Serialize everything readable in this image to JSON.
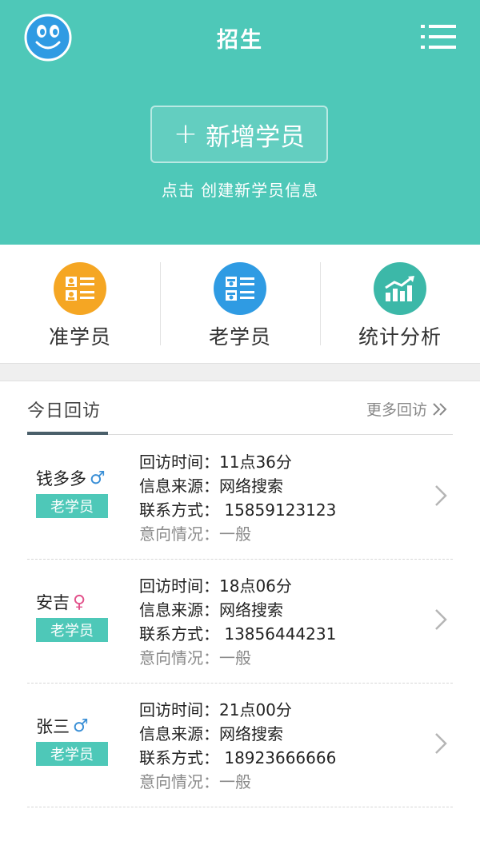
{
  "header": {
    "title": "招生",
    "add_button_label": "新增学员",
    "add_button_plus": "+",
    "hint": "点击 创建新学员信息"
  },
  "shortcuts": [
    {
      "label": "准学员",
      "icon": "prospective-students-icon",
      "color": "#f5a623"
    },
    {
      "label": "老学员",
      "icon": "former-students-icon",
      "color": "#2f9be3"
    },
    {
      "label": "统计分析",
      "icon": "chart-growth-icon",
      "color": "#3cb8a8"
    }
  ],
  "section": {
    "tab_label": "今日回访",
    "more_label": "更多回访"
  },
  "labels": {
    "time": "回访时间：",
    "source": "信息来源：",
    "contact": "联系方式：",
    "intent": "意向情况："
  },
  "visits": [
    {
      "name": "钱多多",
      "gender": "♂",
      "badge": "老学员",
      "time": "11点36分",
      "source": "网络搜索",
      "contact": " 15859123123",
      "intent": "一般"
    },
    {
      "name": "安吉",
      "gender": "♀",
      "badge": "老学员",
      "time": "18点06分",
      "source": "网络搜索",
      "contact": " 13856444231",
      "intent": "一般"
    },
    {
      "name": "张三",
      "gender": "♂",
      "badge": "老学员",
      "time": "21点00分",
      "source": "网络搜索",
      "contact": " 18923666666",
      "intent": "一般"
    }
  ],
  "colors": {
    "accent": "#4ec8b8",
    "orange": "#f5a623",
    "blue": "#2f9be3",
    "teal": "#3cb8a8"
  }
}
